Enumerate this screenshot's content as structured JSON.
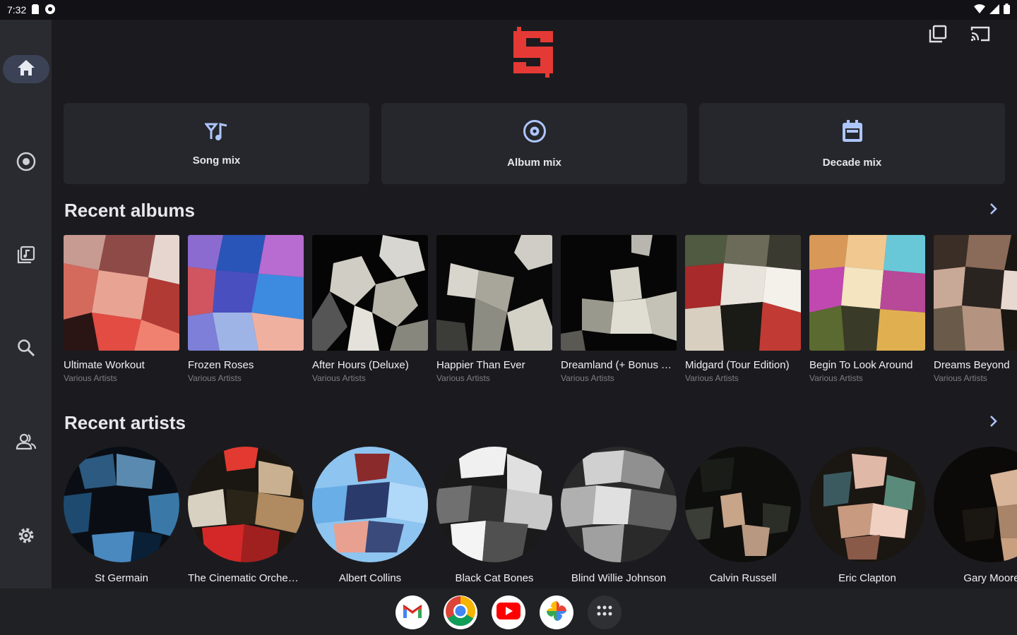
{
  "status": {
    "time": "7:32"
  },
  "nav": {
    "items": [
      {
        "id": "home",
        "icon": "home-icon",
        "active": true
      },
      {
        "id": "albums",
        "icon": "album-icon",
        "active": false
      },
      {
        "id": "library",
        "icon": "music-library-icon",
        "active": false
      },
      {
        "id": "search",
        "icon": "search-icon",
        "active": false
      },
      {
        "id": "artists",
        "icon": "artists-icon",
        "active": false
      },
      {
        "id": "settings",
        "icon": "settings-gear-icon",
        "active": false
      }
    ]
  },
  "header": {
    "logo": "S",
    "actions": [
      "queue-icon",
      "cast-icon"
    ]
  },
  "mixes": [
    {
      "label": "Song mix",
      "icon": "song-mix-icon"
    },
    {
      "label": "Album mix",
      "icon": "album-mix-icon"
    },
    {
      "label": "Decade mix",
      "icon": "calendar-icon"
    }
  ],
  "recent_albums": {
    "title": "Recent albums",
    "items": [
      {
        "title": "Ultimate Workout",
        "artist": "Various Artists"
      },
      {
        "title": "Frozen Roses",
        "artist": "Various Artists"
      },
      {
        "title": "After Hours (Deluxe)",
        "artist": "Various Artists"
      },
      {
        "title": "Happier Than Ever",
        "artist": "Various Artists"
      },
      {
        "title": "Dreamland (+ Bonus Tracks)",
        "artist": "Various Artists"
      },
      {
        "title": "Midgard (Tour Edition)",
        "artist": "Various Artists"
      },
      {
        "title": "Begin To Look Around",
        "artist": "Various Artists"
      },
      {
        "title": "Dreams Beyond",
        "artist": "Various Artists"
      }
    ]
  },
  "recent_artists": {
    "title": "Recent artists",
    "items": [
      {
        "name": "St Germain"
      },
      {
        "name": "The Cinematic Orchestra"
      },
      {
        "name": "Albert Collins"
      },
      {
        "name": "Black Cat Bones"
      },
      {
        "name": "Blind Willie Johnson"
      },
      {
        "name": "Calvin Russell"
      },
      {
        "name": "Eric Clapton"
      },
      {
        "name": "Gary Moore"
      }
    ]
  },
  "dock": [
    "gmail-icon",
    "chrome-icon",
    "youtube-icon",
    "photos-icon",
    "app-launcher-icon"
  ],
  "colors": {
    "accent": "#e53935",
    "nav_active": "#3c4256",
    "link": "#aec6ff"
  }
}
